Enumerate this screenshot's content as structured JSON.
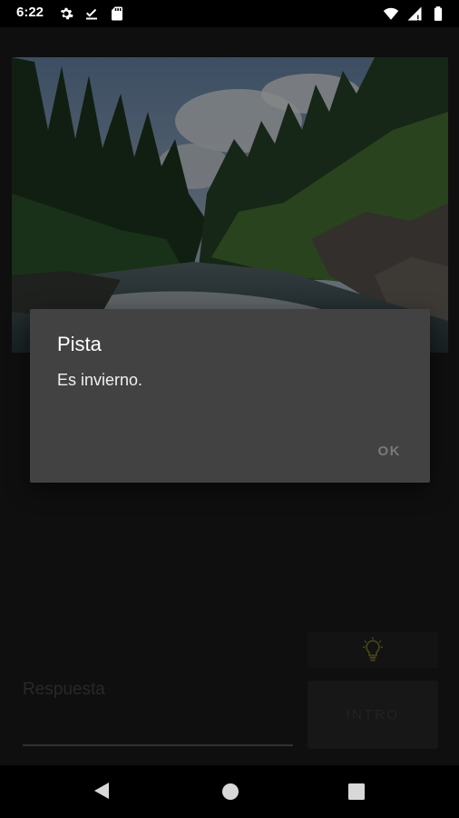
{
  "status_bar": {
    "time": "6:22",
    "left_icons": [
      "settings-icon",
      "download-done-icon",
      "sd-card-icon"
    ],
    "right_icons": [
      "wifi-icon",
      "cell-signal-icon",
      "battery-icon"
    ]
  },
  "app": {
    "answer_label": "Respuesta",
    "enter_button_label": "INTRO",
    "hint_icon": "lightbulb-icon",
    "hint_icon_color": "#d4c24a"
  },
  "dialog": {
    "title": "Pista",
    "message": "Es invierno.",
    "ok_label": "OK"
  },
  "nav_bar": {
    "icons": [
      "back-icon",
      "home-icon",
      "recents-icon"
    ]
  }
}
